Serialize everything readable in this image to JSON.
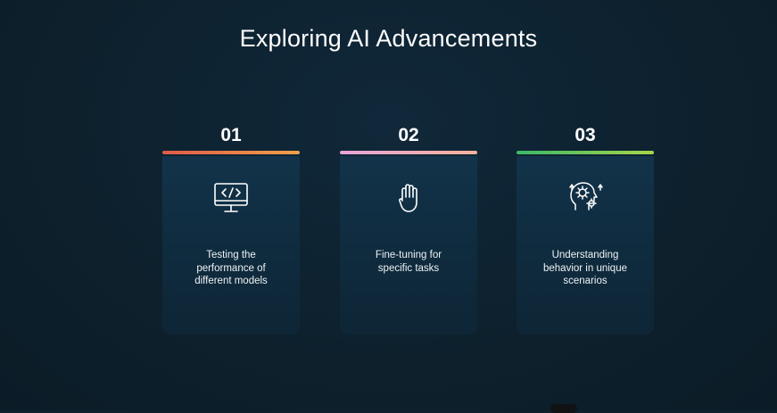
{
  "slide": {
    "title": "Exploring AI Advancements"
  },
  "steps": [
    {
      "number": "01",
      "text": "Testing the\nperformance of\ndifferent models",
      "icon": "monitor-code-icon",
      "accent": [
        "#e05a4a",
        "#f2a14a"
      ]
    },
    {
      "number": "02",
      "text": "Fine-tuning for\nspecific tasks",
      "icon": "raised-hand-icon",
      "accent": [
        "#e6a6d8",
        "#f3b29a"
      ]
    },
    {
      "number": "03",
      "text": "Understanding\nbehavior in unique\nscenarios",
      "icon": "head-gears-icon",
      "accent": [
        "#3bb86a",
        "#a6d64a"
      ]
    }
  ]
}
